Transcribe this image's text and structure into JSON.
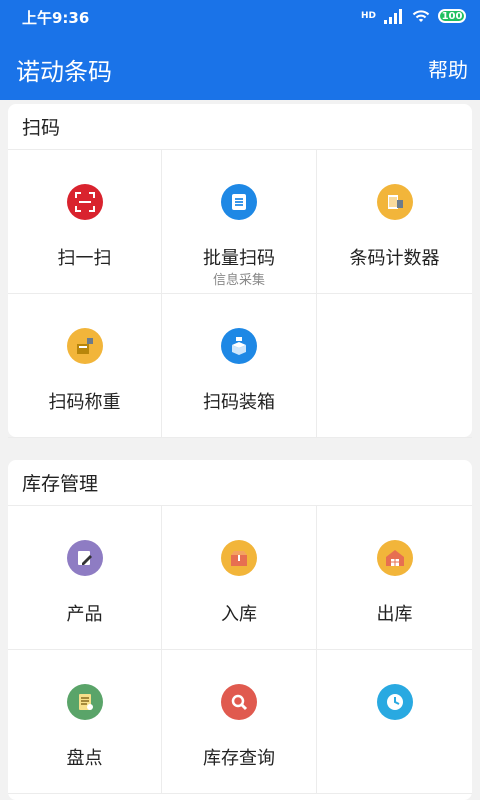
{
  "status": {
    "time": "上午9:36",
    "battery": "100",
    "hd_label": "HD"
  },
  "appbar": {
    "title": "诺动条码",
    "help": "帮助"
  },
  "sections": [
    {
      "title": "扫码",
      "items": [
        {
          "label": "扫一扫",
          "sub": ""
        },
        {
          "label": "批量扫码",
          "sub": "信息采集"
        },
        {
          "label": "条码计数器",
          "sub": ""
        },
        {
          "label": "扫码称重",
          "sub": ""
        },
        {
          "label": "扫码装箱",
          "sub": ""
        }
      ]
    },
    {
      "title": "库存管理",
      "items": [
        {
          "label": "产品",
          "sub": ""
        },
        {
          "label": "入库",
          "sub": ""
        },
        {
          "label": "出库",
          "sub": ""
        },
        {
          "label": "盘点",
          "sub": ""
        },
        {
          "label": "库存查询",
          "sub": ""
        },
        {
          "label": "",
          "sub": ""
        }
      ]
    }
  ],
  "colors": {
    "primary": "#1a73e8",
    "red": "#d9232e",
    "blue": "#1e88e5",
    "yellow": "#f2b53a",
    "purple": "#8e7cc3",
    "green": "#5aa469",
    "redIcon": "#e05a4f",
    "teal": "#29a9e1"
  },
  "icons": {
    "scan": "scan-icon",
    "batch": "list-doc-icon",
    "counter": "barcode-counter-icon",
    "weigh": "scale-box-icon",
    "pack": "box-scan-icon",
    "product": "edit-doc-icon",
    "inbound": "open-box-icon",
    "outbound": "warehouse-icon",
    "stocktake": "checklist-icon",
    "query": "search-icon",
    "clock": "clock-icon"
  }
}
